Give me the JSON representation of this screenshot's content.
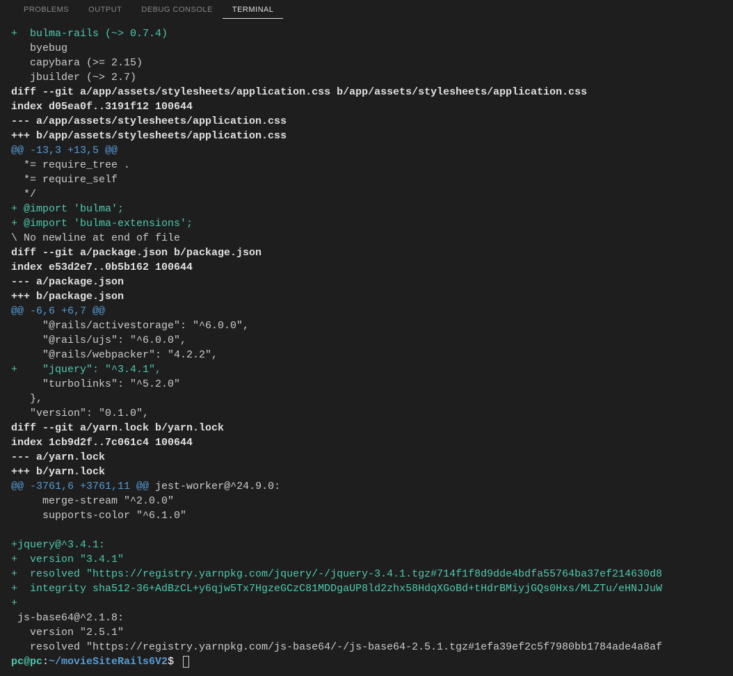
{
  "tabs": {
    "problems": "PROBLEMS",
    "output": "OUTPUT",
    "debug": "DEBUG CONSOLE",
    "terminal": "TERMINAL"
  },
  "lines": [
    {
      "cls": "added",
      "text": "+  bulma-rails (~> 0.7.4)"
    },
    {
      "cls": "plain",
      "text": "   byebug"
    },
    {
      "cls": "plain",
      "text": "   capybara (>= 2.15)"
    },
    {
      "cls": "plain",
      "text": "   jbuilder (~> 2.7)"
    },
    {
      "cls": "bold",
      "text": "diff --git a/app/assets/stylesheets/application.css b/app/assets/stylesheets/application.css"
    },
    {
      "cls": "bold",
      "text": "index d05ea0f..3191f12 100644"
    },
    {
      "cls": "bold",
      "text": "--- a/app/assets/stylesheets/application.css"
    },
    {
      "cls": "bold",
      "text": "+++ b/app/assets/stylesheets/application.css"
    },
    {
      "cls": "hunk",
      "text": "@@ -13,3 +13,5 @@"
    },
    {
      "cls": "plain",
      "text": "  *= require_tree ."
    },
    {
      "cls": "plain",
      "text": "  *= require_self"
    },
    {
      "cls": "plain",
      "text": "  */"
    },
    {
      "cls": "added",
      "text": "+ @import 'bulma';"
    },
    {
      "cls": "added",
      "text": "+ @import 'bulma-extensions';"
    },
    {
      "cls": "plain",
      "text": "\\ No newline at end of file"
    },
    {
      "cls": "bold",
      "text": "diff --git a/package.json b/package.json"
    },
    {
      "cls": "bold",
      "text": "index e53d2e7..0b5b162 100644"
    },
    {
      "cls": "bold",
      "text": "--- a/package.json"
    },
    {
      "cls": "bold",
      "text": "+++ b/package.json"
    },
    {
      "cls": "hunk",
      "text": "@@ -6,6 +6,7 @@"
    },
    {
      "cls": "plain",
      "text": "     \"@rails/activestorage\": \"^6.0.0\","
    },
    {
      "cls": "plain",
      "text": "     \"@rails/ujs\": \"^6.0.0\","
    },
    {
      "cls": "plain",
      "text": "     \"@rails/webpacker\": \"4.2.2\","
    },
    {
      "cls": "added",
      "text": "+    \"jquery\": \"^3.4.1\","
    },
    {
      "cls": "plain",
      "text": "     \"turbolinks\": \"^5.2.0\""
    },
    {
      "cls": "plain",
      "text": "   },"
    },
    {
      "cls": "plain",
      "text": "   \"version\": \"0.1.0\","
    },
    {
      "cls": "bold",
      "text": "diff --git a/yarn.lock b/yarn.lock"
    },
    {
      "cls": "bold",
      "text": "index 1cb9d2f..7c061c4 100644"
    },
    {
      "cls": "bold",
      "text": "--- a/yarn.lock"
    },
    {
      "cls": "bold",
      "text": "+++ b/yarn.lock"
    },
    {
      "cls": "hunkcontext",
      "hunk": "@@ -3761,6 +3761,11 @@",
      "ctx": " jest-worker@^24.9.0:"
    },
    {
      "cls": "plain",
      "text": "     merge-stream \"^2.0.0\""
    },
    {
      "cls": "plain",
      "text": "     supports-color \"^6.1.0\""
    },
    {
      "cls": "plain",
      "text": " "
    },
    {
      "cls": "added",
      "text": "+jquery@^3.4.1:"
    },
    {
      "cls": "added",
      "text": "+  version \"3.4.1\""
    },
    {
      "cls": "added",
      "text": "+  resolved \"https://registry.yarnpkg.com/jquery/-/jquery-3.4.1.tgz#714f1f8d9dde4bdfa55764ba37ef214630d8"
    },
    {
      "cls": "added",
      "text": "+  integrity sha512-36+AdBzCL+y6qjw5Tx7HgzeGCzC81MDDgaUP8ld2zhx58HdqXGoBd+tHdrBMiyjGQs0Hxs/MLZTu/eHNJJuW"
    },
    {
      "cls": "added",
      "text": "+"
    },
    {
      "cls": "plain",
      "text": " js-base64@^2.1.8:"
    },
    {
      "cls": "plain",
      "text": "   version \"2.5.1\""
    },
    {
      "cls": "plain",
      "text": "   resolved \"https://registry.yarnpkg.com/js-base64/-/js-base64-2.5.1.tgz#1efa39ef2c5f7980bb1784ade4a8af"
    }
  ],
  "prompt": {
    "user": "pc@pc",
    "colon": ":",
    "path": "~/movieSiteRails6V2",
    "dollar": "$ "
  }
}
